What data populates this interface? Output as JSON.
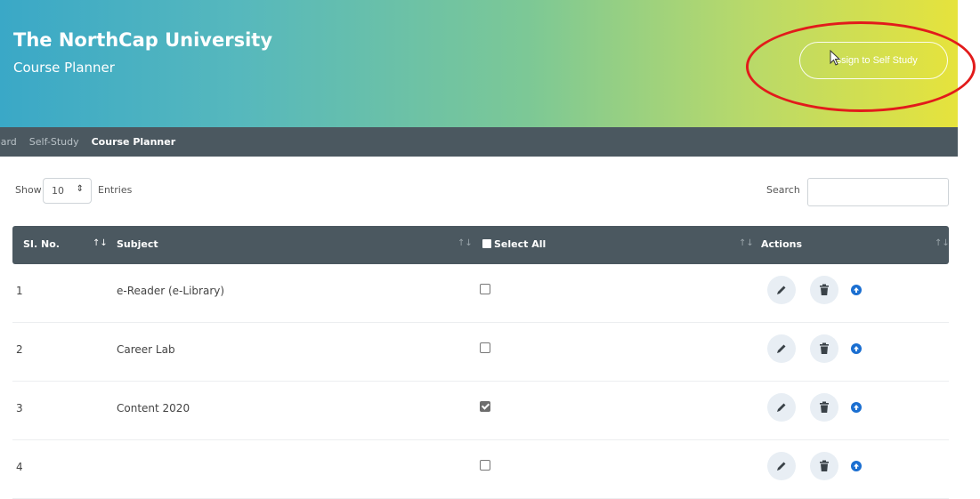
{
  "header": {
    "title": "The NorthCap University",
    "subtitle": "Course Planner",
    "assign_button": "Assign to Self Study"
  },
  "breadcrumb": [
    "oard",
    "Self-Study",
    "Course Planner"
  ],
  "controls": {
    "show_label": "Show",
    "entries_value": "10",
    "entries_label": "Entries",
    "search_label": "Search",
    "search_value": ""
  },
  "table": {
    "columns": {
      "sl_no": "SI. No.",
      "subject": "Subject",
      "select_all": "Select All",
      "actions": "Actions"
    },
    "rows": [
      {
        "sl": "1",
        "subject": "e-Reader (e-Library)",
        "checked": false
      },
      {
        "sl": "2",
        "subject": "Career Lab",
        "checked": false
      },
      {
        "sl": "3",
        "subject": "Content 2020",
        "checked": true
      },
      {
        "sl": "4",
        "subject": "",
        "checked": false
      }
    ]
  },
  "colors": {
    "header_gradient_start": "#3aa8c7",
    "header_gradient_end": "#e6e33c",
    "bar_dark": "#4b5860",
    "accent_blue": "#1b6fd1",
    "annotation_red": "#e21b1b"
  },
  "icons": {
    "edit": "pencil-icon",
    "delete": "trash-icon",
    "upload": "arrow-up-circle-icon",
    "sort": "sort-arrows-icon"
  }
}
